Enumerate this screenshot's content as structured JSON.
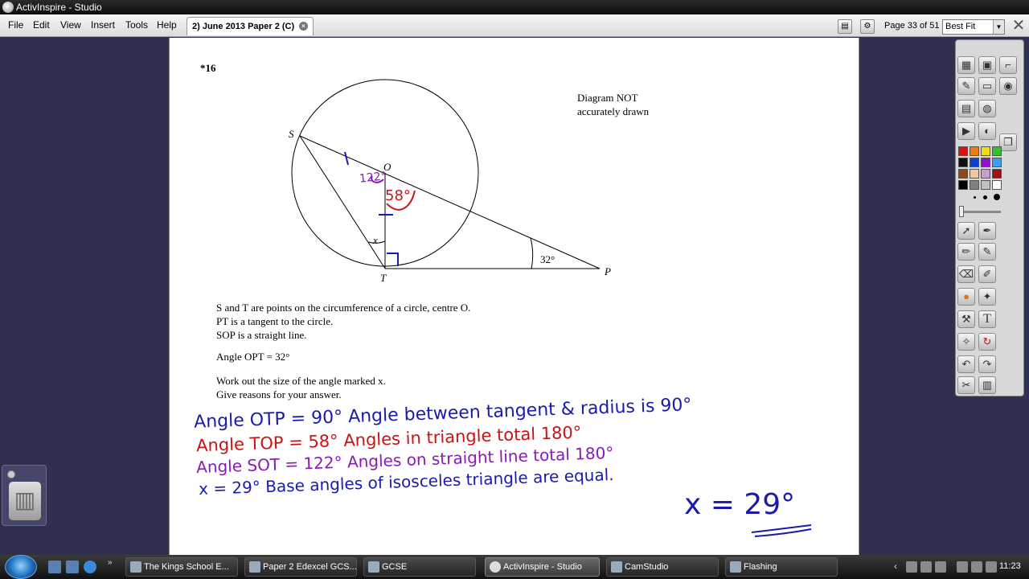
{
  "window": {
    "title": "ActivInspire - Studio"
  },
  "menubar": {
    "items": [
      "File",
      "Edit",
      "View",
      "Insert",
      "Tools",
      "Help"
    ]
  },
  "document_tab": {
    "label": "2) June 2013 Paper 2 (C)"
  },
  "toolbar": {
    "page_counter": "Page 33 of 51",
    "zoom": "Best Fit"
  },
  "question": {
    "number": "*16",
    "diagram_note_line1": "Diagram NOT",
    "diagram_note_line2": "accurately drawn",
    "labels": {
      "S": "S",
      "O": "O",
      "T": "T",
      "P": "P",
      "x": "x",
      "angle_p": "32°"
    },
    "statements": [
      "S and T are points on the circumference of a circle, centre O.",
      "PT is a tangent to the circle.",
      "SOP is a straight line."
    ],
    "angle_given": "Angle OPT = 32°",
    "instruction1": "Work out the size of the angle marked x.",
    "instruction2": "Give reasons for your answer."
  },
  "annotations": {
    "diagram_angle_122": "122°",
    "diagram_angle_58": "58°",
    "line1": "Angle OTP = 90°  Angle between tangent & radius is 90°",
    "line2": "Angle TOP = 58°  Angles in triangle total 180°",
    "line3": "Angle SOT = 122°  Angles on straight line total 180°",
    "line4": "x = 29°  Base angles of isosceles triangle are equal.",
    "answer": "x = 29°"
  },
  "colors": {
    "ink_blue": "#1a1ab0",
    "ink_red": "#c81414",
    "ink_purple": "#8a1ab8",
    "workspace": "#2f2f4f"
  },
  "toolbox": {
    "palette": [
      "#e01010",
      "#f07a10",
      "#f0e010",
      "#30c030",
      "#101010",
      "#1040d0",
      "#9010d0",
      "#40a0f0",
      "#8a4a1a",
      "#f0c8a0",
      "#c8a0d0",
      "#a01010",
      "#000000",
      "#808080",
      "#c0c0c0",
      "#ffffff"
    ],
    "icons": [
      "pages-icon",
      "resources-icon",
      "graph-icon",
      "notes-icon",
      "projector-icon",
      "mouse-icon",
      "pen-icon",
      "highlighter-icon",
      "eraser-icon",
      "fill-icon",
      "text-icon",
      "undo-icon",
      "redo-icon",
      "trash-icon"
    ]
  },
  "taskbar": {
    "tasks": [
      "The Kings School E...",
      "Paper 2 Edexcel GCS...",
      "GCSE",
      "ActivInspire - Studio",
      "CamStudio",
      "Flashing"
    ],
    "clock": "11:23"
  }
}
